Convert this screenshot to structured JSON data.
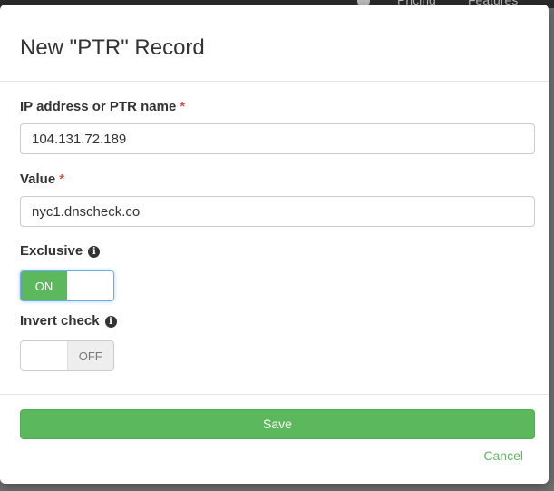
{
  "background_nav": {
    "links": [
      "Pricing",
      "Features"
    ]
  },
  "modal": {
    "title": "New \"PTR\" Record",
    "fields": {
      "ip": {
        "label": "IP address or PTR name",
        "required_mark": "*",
        "value": "104.131.72.189"
      },
      "value": {
        "label": "Value",
        "required_mark": "*",
        "value": "nyc1.dnscheck.co"
      },
      "exclusive": {
        "label": "Exclusive",
        "info_icon": "info-circle-icon",
        "state": "ON",
        "on_label": "ON"
      },
      "invert": {
        "label": "Invert check",
        "info_icon": "info-circle-icon",
        "state": "OFF",
        "off_label": "OFF"
      }
    },
    "save_label": "Save",
    "cancel_label": "Cancel"
  },
  "colors": {
    "accent_green": "#5cb85c",
    "required_red": "#d9534f",
    "focus_blue": "#66afe9"
  }
}
